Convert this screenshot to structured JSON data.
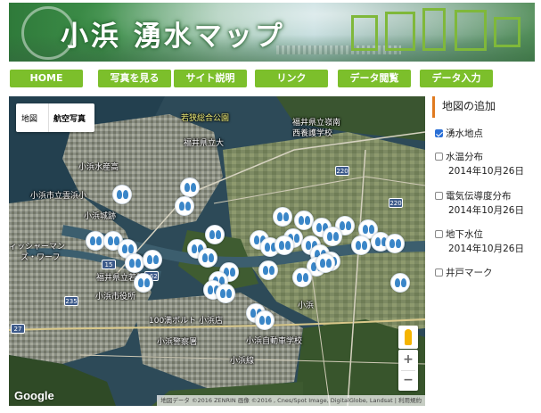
{
  "banner": {
    "title": "小浜 湧水マップ"
  },
  "nav": [
    {
      "label": "HOME"
    },
    {
      "label": "写真を見る"
    },
    {
      "label": "サイト説明"
    },
    {
      "label": "リンク"
    },
    {
      "label": "データ閲覧"
    },
    {
      "label": "データ入力"
    }
  ],
  "map": {
    "type_control": {
      "map": "地図",
      "satellite": "航空写真"
    },
    "labels": [
      {
        "text": "若狭総合公園",
        "cls": "yel"
      },
      {
        "text": "福井県立大"
      },
      {
        "text": "福井県立嶺南"
      },
      {
        "text": "西養護学校"
      },
      {
        "text": "小浜水産高"
      },
      {
        "text": "小浜市立雲浜小"
      },
      {
        "text": "小浜城跡"
      },
      {
        "text": "ィッシャーマン"
      },
      {
        "text": "ズ・ワーフ"
      },
      {
        "text": "福井県立若狭高"
      },
      {
        "text": "小浜市役所"
      },
      {
        "text": "100満ボルト 小浜店"
      },
      {
        "text": "小浜警察署"
      },
      {
        "text": "小浜自動車学校"
      },
      {
        "text": "小浜線"
      },
      {
        "text": "小浜"
      }
    ],
    "shields": [
      "220",
      "220",
      "15",
      "235",
      "27",
      "162",
      "小浜"
    ],
    "google": "Google",
    "attribution": "地図データ ©2016 ZENRIN 画像 ©2016 , Cnes/Spot Image, DigitalGlobe, Landsat | 利用規約",
    "zoom_in": "+",
    "zoom_out": "−"
  },
  "panel": {
    "title": "地図の追加",
    "items": [
      {
        "label": "湧水地点",
        "checked": true,
        "date": ""
      },
      {
        "label": "水温分布",
        "checked": false,
        "date": "2014年10月26日"
      },
      {
        "label": "電気伝導度分布",
        "checked": false,
        "date": "2014年10月26日"
      },
      {
        "label": "地下水位",
        "checked": false,
        "date": "2014年10月26日"
      },
      {
        "label": "井戸マーク",
        "checked": false,
        "date": ""
      }
    ]
  },
  "colors": {
    "nav_green": "#7cbf2b",
    "panel_accent": "#e07a1f",
    "pin_blue": "#3a86c8"
  }
}
